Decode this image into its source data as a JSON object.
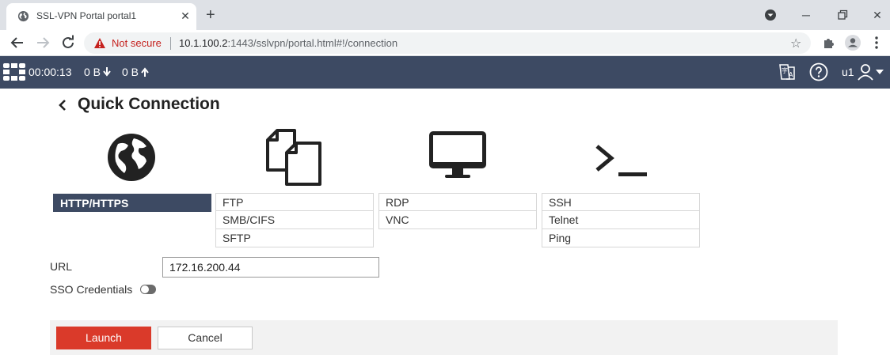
{
  "browser": {
    "tab_title": "SSL-VPN Portal portal1",
    "security_label": "Not secure",
    "url_host": "10.1.100.2",
    "url_rest": ":1443/sslvpn/portal.html#!/connection"
  },
  "portal_bar": {
    "session_time": "00:00:13",
    "bytes_down": "0 B",
    "bytes_up": "0 B",
    "username": "u1"
  },
  "page": {
    "title": "Quick Connection"
  },
  "protocols": {
    "web": [
      "HTTP/HTTPS"
    ],
    "file": [
      "FTP",
      "SMB/CIFS",
      "SFTP"
    ],
    "desktop": [
      "RDP",
      "VNC"
    ],
    "terminal": [
      "SSH",
      "Telnet",
      "Ping"
    ],
    "selected": "HTTP/HTTPS"
  },
  "form": {
    "url_label": "URL",
    "url_value": "172.16.200.44",
    "sso_label": "SSO Credentials",
    "sso_enabled": false
  },
  "actions": {
    "launch_label": "Launch",
    "cancel_label": "Cancel"
  },
  "colors": {
    "header_bg": "#3d4a63",
    "launch_bg": "#da3a2a",
    "not_secure": "#c5221f"
  }
}
